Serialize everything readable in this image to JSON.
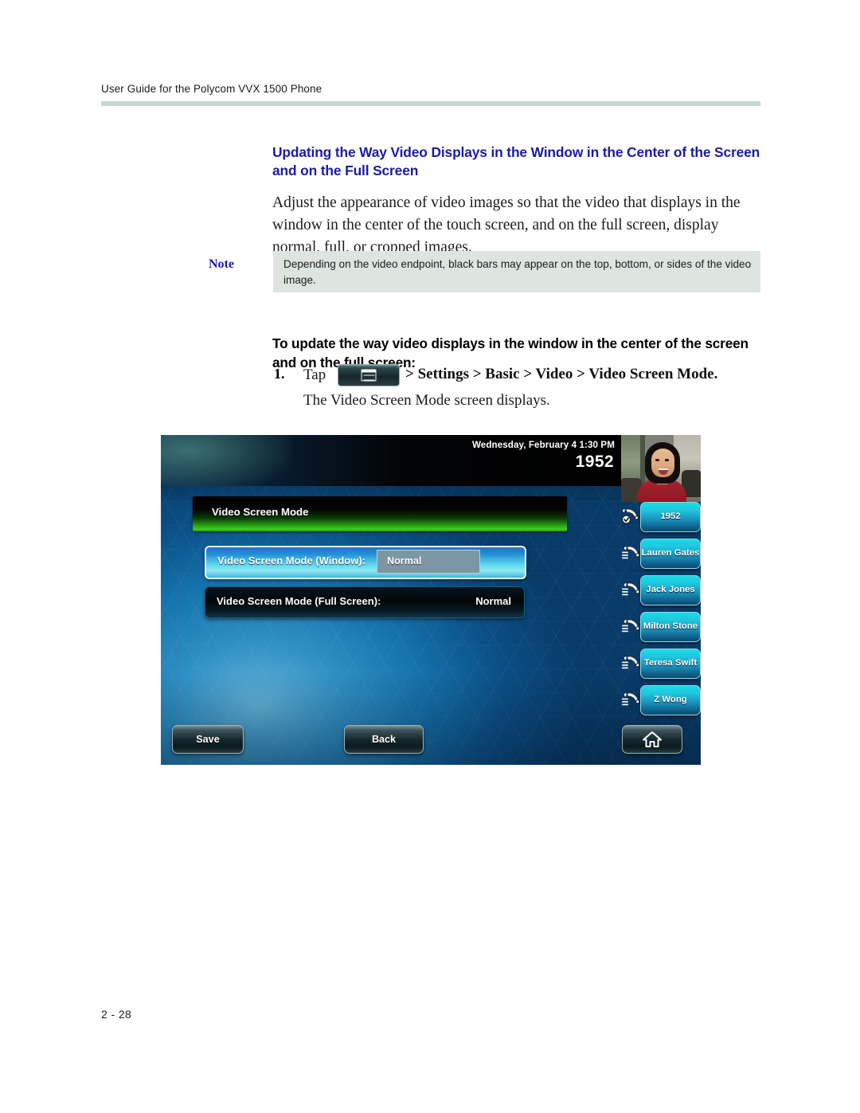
{
  "page": {
    "running_header": "User Guide for the Polycom VVX 1500 Phone",
    "footer": "2 - 28",
    "accent_blue": "#1b1ba8",
    "rule_color": "#c7d6d2",
    "note_bg": "#dde5e0"
  },
  "section": {
    "heading": "Updating the Way Video Displays in the Window in the Center of the Screen and on the Full Screen",
    "paragraph": "Adjust the appearance of video images so that the video that displays in the window in the center of the touch screen, and on the full screen, display normal, full, or cropped images."
  },
  "note": {
    "label": "Note",
    "text": "Depending on the video endpoint, black bars may appear on the top, bottom, or sides of the video image."
  },
  "procedure": {
    "heading": "To update the way video displays in the window in the center of the screen and on the full screen:",
    "step_number": "1.",
    "step_tap_word": "Tap",
    "step_menu_icon": "menu-key-icon",
    "step_path": "> Settings > Basic > Video > Video Screen Mode.",
    "step_result": "The Video Screen Mode screen displays."
  },
  "phone": {
    "status": {
      "datetime": "Wednesday, February 4  1:30 PM",
      "extension": "1952"
    },
    "video_thumbnail": "self-view-video",
    "screen_title": "Video Screen Mode",
    "menu_rows": [
      {
        "label": "Video Screen Mode (Window):",
        "value": "Normal",
        "selected": true
      },
      {
        "label": "Video Screen Mode (Full Screen):",
        "value": "Normal",
        "selected": false
      }
    ],
    "line_keys": [
      {
        "label": "1952",
        "icon": "handset-registered-icon"
      },
      {
        "label": "Lauren Gates",
        "icon": "handset-icon"
      },
      {
        "label": "Jack Jones",
        "icon": "handset-icon"
      },
      {
        "label": "Milton Stone",
        "icon": "handset-icon"
      },
      {
        "label": "Teresa Swift",
        "icon": "handset-icon"
      },
      {
        "label": "Z Wong",
        "icon": "handset-icon"
      }
    ],
    "soft_keys": [
      {
        "label": "Save",
        "icon": ""
      },
      {
        "label": "Back",
        "icon": ""
      },
      {
        "label": "",
        "icon": "home-icon"
      }
    ]
  }
}
